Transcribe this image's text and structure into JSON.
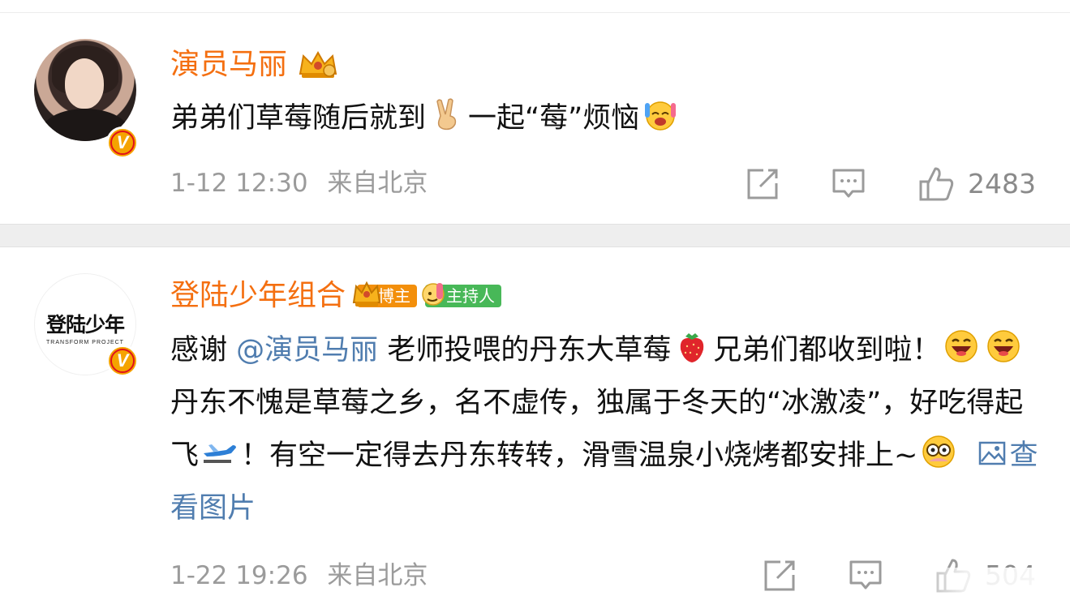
{
  "posts": [
    {
      "author": "演员马丽",
      "verified": "V",
      "text_before": "弟弟们草莓随后就到",
      "text_middle": "一起“莓”烦恼",
      "timestamp": "1-12 12:30",
      "source": "来自北京",
      "like_count": "2483",
      "emoji_1": "victory-hand-emoji",
      "emoji_2": "grimace-cry-emoji"
    },
    {
      "author": "登陆少年组合",
      "verified": "V",
      "avatar_logo": "登陆少年",
      "avatar_logo_sub": "TRANSFORM PROJECT",
      "tags": [
        "博主",
        "主持人"
      ],
      "text_1": "感谢",
      "mention": "@演员马丽",
      "text_2": "老师投喂的丹东大草莓",
      "text_3": "兄弟们都收到啦！",
      "text_4": "丹东不愧是草莓之乡，名不虚传，独属于冬天的“冰激凌”，好吃得起飞",
      "text_5": "！有空一定得去丹东转转，滑雪温泉小烧烤都安排上~",
      "link_label": "查看图片",
      "timestamp": "1-22 19:26",
      "source": "来自北京",
      "like_count": "504"
    }
  ],
  "colors": {
    "username": "#f46f10",
    "link": "#507daf",
    "meta": "#9b9b9b",
    "badge_orange": "#f38f0b",
    "badge_green": "#48b858"
  }
}
